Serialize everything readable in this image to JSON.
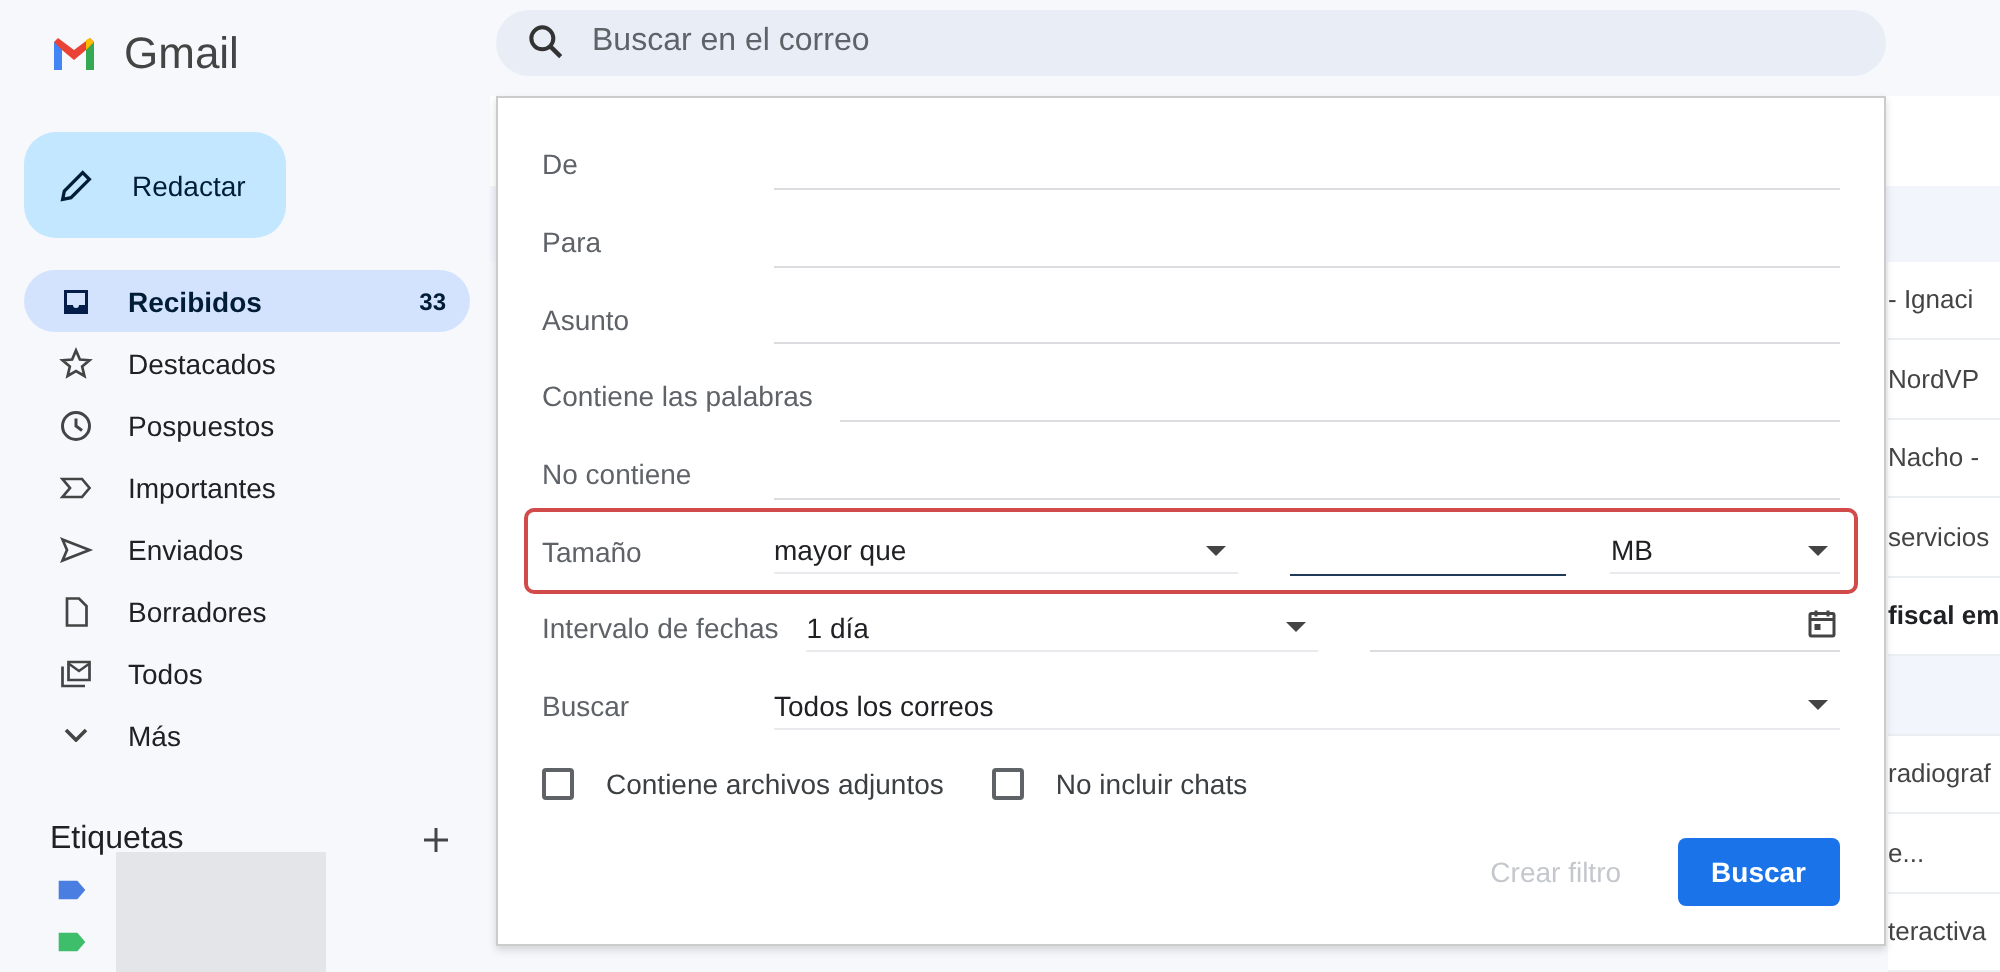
{
  "app": {
    "name": "Gmail"
  },
  "compose": {
    "label": "Redactar"
  },
  "sidebar": {
    "items": [
      {
        "label": "Recibidos",
        "count": "33",
        "selected": true
      },
      {
        "label": "Destacados",
        "selected": false
      },
      {
        "label": "Pospuestos",
        "selected": false
      },
      {
        "label": "Importantes",
        "selected": false
      },
      {
        "label": "Enviados",
        "selected": false
      },
      {
        "label": "Borradores",
        "selected": false
      },
      {
        "label": "Todos",
        "selected": false
      },
      {
        "label": "Más",
        "selected": false
      }
    ]
  },
  "labels": {
    "title": "Etiquetas",
    "items": [
      {
        "color": "#4a7ee0"
      },
      {
        "color": "#3ebd6b"
      }
    ]
  },
  "search": {
    "placeholder": "Buscar en el correo"
  },
  "mail_list": {
    "rows": [
      {
        "text": "- Ignaci",
        "unread": false
      },
      {
        "text": "NordVP",
        "unread": false
      },
      {
        "text": "Nacho -",
        "unread": false
      },
      {
        "text": "servicios",
        "unread": false
      },
      {
        "text": "fiscal em",
        "unread": true
      },
      {
        "kind": "blank"
      },
      {
        "text": "radiograf",
        "unread": false
      },
      {
        "text": "e...",
        "unread": false
      },
      {
        "text": "teractiva",
        "unread": false
      }
    ]
  },
  "search_panel": {
    "fields": [
      {
        "kind": "text",
        "label": "De"
      },
      {
        "kind": "text",
        "label": "Para"
      },
      {
        "kind": "text",
        "label": "Asunto"
      },
      {
        "kind": "text",
        "label": "Contiene las palabras"
      },
      {
        "kind": "text",
        "label": "No contiene"
      },
      {
        "kind": "size",
        "label": "Tamaño",
        "operator": "mayor que",
        "unit": "MB",
        "highlighted": true
      },
      {
        "kind": "date",
        "label": "Intervalo de fechas",
        "range": "1 día"
      },
      {
        "kind": "select",
        "label": "Buscar",
        "value": "Todos los correos"
      }
    ],
    "checkboxes": [
      {
        "label": "Contiene archivos adjuntos",
        "checked": false
      },
      {
        "label": "No incluir chats",
        "checked": false
      }
    ],
    "buttons": [
      {
        "label": "Crear filtro",
        "disabled": true
      },
      {
        "label": "Buscar",
        "disabled": false
      }
    ]
  }
}
